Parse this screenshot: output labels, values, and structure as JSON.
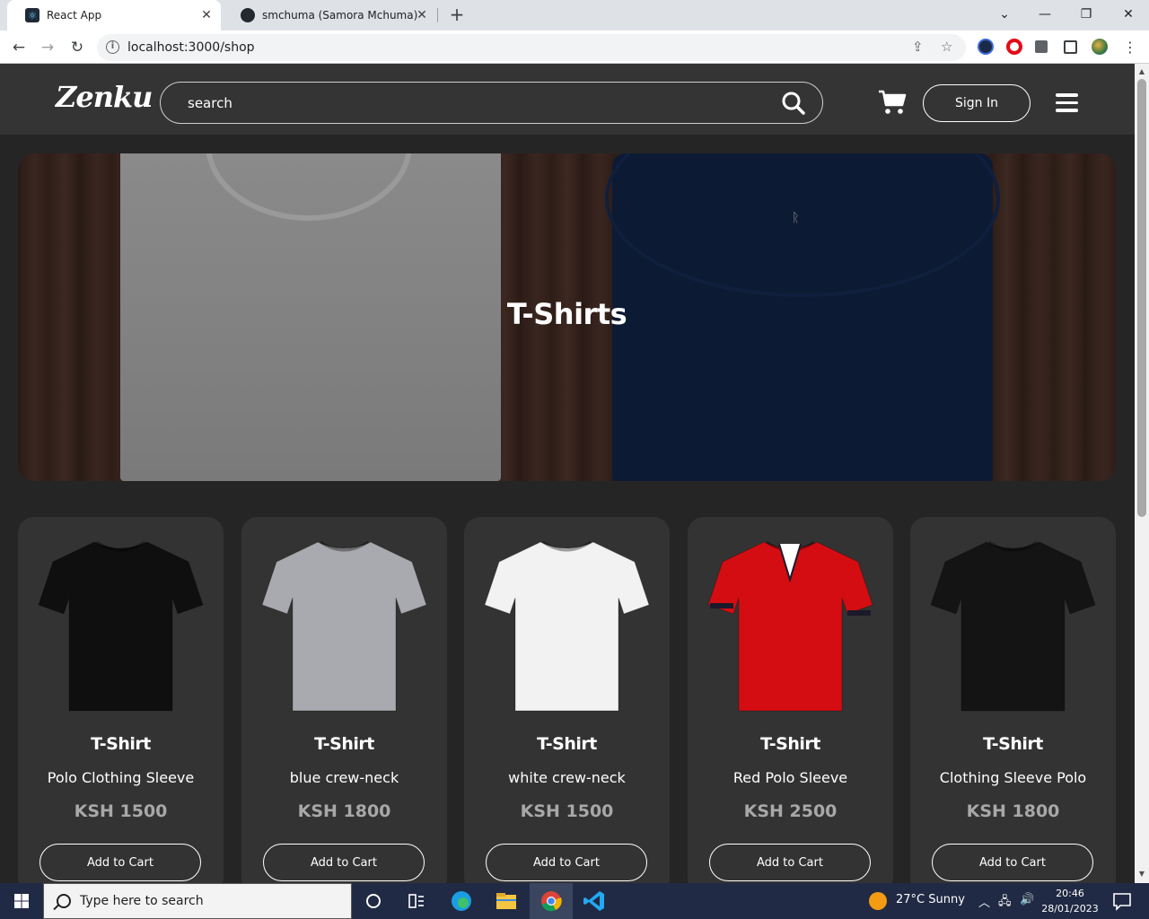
{
  "browser": {
    "tabs": [
      {
        "title": "React App"
      },
      {
        "title": "smchuma (Samora Mchuma)"
      }
    ],
    "url": "localhost:3000/shop"
  },
  "header": {
    "logo": "Zenku",
    "search_placeholder": "search",
    "signin_label": "Sign In"
  },
  "hero": {
    "title": "T-Shirts"
  },
  "products": [
    {
      "category": "T-Shirt",
      "name": "Polo Clothing Sleeve",
      "price": "KSH 1500",
      "add_label": "Add to Cart",
      "color": "#0f0f0f"
    },
    {
      "category": "T-Shirt",
      "name": "blue crew-neck",
      "price": "KSH 1800",
      "add_label": "Add to Cart",
      "color": "#a9a9b0"
    },
    {
      "category": "T-Shirt",
      "name": "white crew-neck",
      "price": "KSH 1500",
      "add_label": "Add to Cart",
      "color": "#f2f2f2"
    },
    {
      "category": "T-Shirt",
      "name": "Red Polo Sleeve",
      "price": "KSH 2500",
      "add_label": "Add to Cart",
      "color": "#d40d12"
    },
    {
      "category": "T-Shirt",
      "name": "Clothing Sleeve Polo",
      "price": "KSH 1800",
      "add_label": "Add to Cart",
      "color": "#141414"
    }
  ],
  "taskbar": {
    "search_placeholder": "Type here to search",
    "weather": "27°C  Sunny",
    "time": "20:46",
    "date": "28/01/2023"
  },
  "colors": {
    "page_bg": "#252525",
    "header_bg": "#343434",
    "card_bg": "#333333",
    "price_text": "#a8a8a8"
  }
}
